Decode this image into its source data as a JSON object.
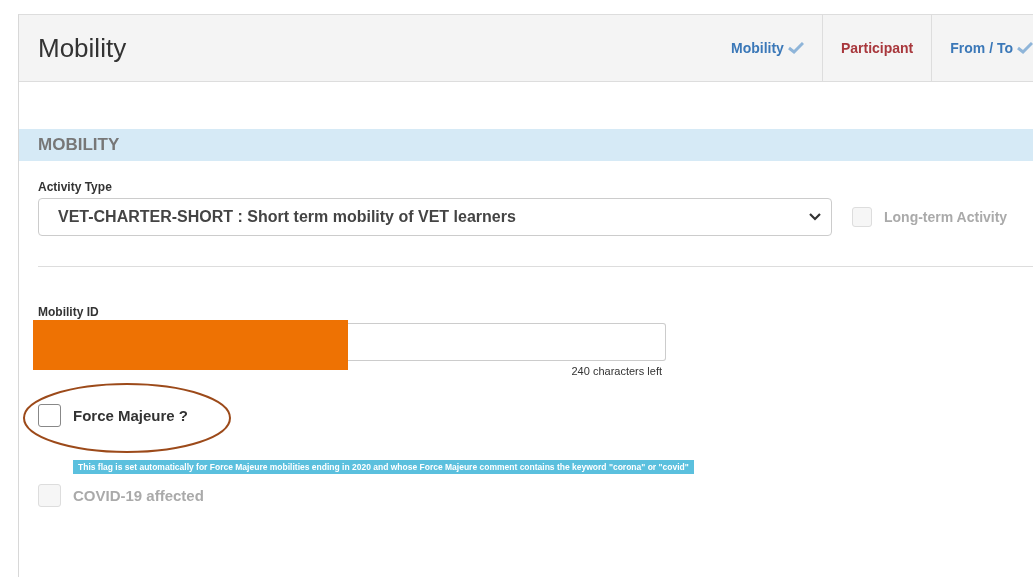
{
  "header": {
    "title": "Mobility",
    "tabs": [
      {
        "label": "Mobility",
        "complete": true
      },
      {
        "label": "Participant",
        "complete": false
      },
      {
        "label": "From / To",
        "complete": true
      }
    ]
  },
  "section": {
    "heading": "MOBILITY"
  },
  "activity_type": {
    "label": "Activity Type",
    "value": "VET-CHARTER-SHORT : Short term mobility of VET learners",
    "long_term": {
      "label": "Long-term Activity",
      "checked": false,
      "disabled": true
    }
  },
  "mobility_id": {
    "label": "Mobility ID",
    "redacted": true,
    "counter": "240 characters left"
  },
  "force_majeure": {
    "label": "Force Majeure ?",
    "checked": false,
    "highlighted": true
  },
  "info_banner": "This flag is set automatically for Force Majeure mobilities ending in 2020 and whose Force Majeure comment contains the keyword \"corona\" or \"covid\"",
  "covid": {
    "label": "COVID-19 affected",
    "checked": false,
    "disabled": true
  }
}
